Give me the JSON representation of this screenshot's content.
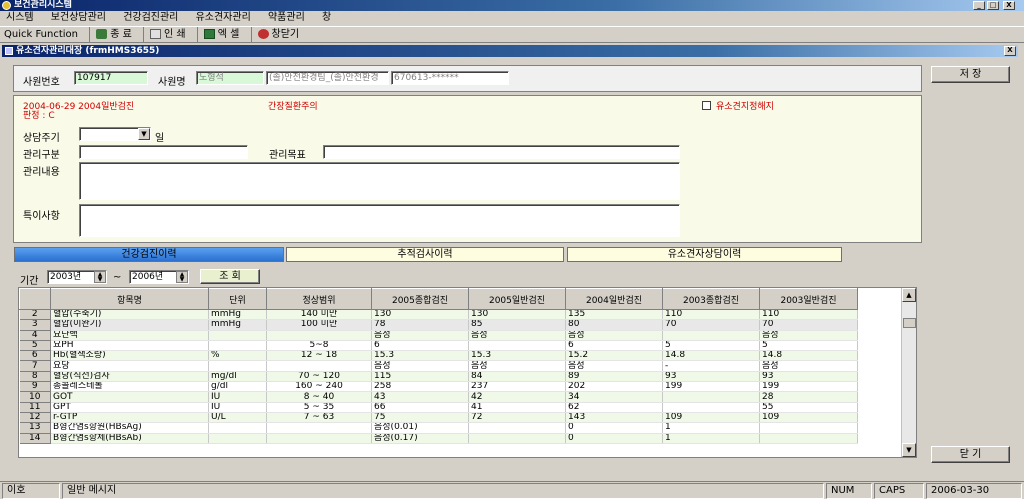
{
  "app": {
    "title": "보건관리시스템",
    "min": "_",
    "restore": "□",
    "close": "X"
  },
  "menu": [
    "시스템",
    "보건상담관리",
    "건강검진관리",
    "유소견자관리",
    "약품관리",
    "창"
  ],
  "quickbar": {
    "label": "Quick Function",
    "items": [
      "종 료",
      "인 쇄",
      "엑 셀",
      "창닫기"
    ]
  },
  "child": {
    "title": "유소견자관리대장 (frmHMS3655)",
    "close": "X"
  },
  "employee": {
    "id_label": "사원번호",
    "id_value": "107917",
    "name_label": "사원명",
    "name_value": "노형석",
    "dept_value": "(졸)안전환경팀_(졸)안전환경",
    "ssn_value": "670613-******"
  },
  "exam": {
    "line1": "2004-06-29 2004일반검진",
    "line2": "판정 : C",
    "warning": "간장질환주의",
    "release_label": "유소견지정해지"
  },
  "form": {
    "cycle_label": "상담주기",
    "cycle_unit": "일",
    "mgmt_type_label": "관리구분",
    "mgmt_goal_label": "관리목표",
    "mgmt_content_label": "관리내용",
    "special_label": "특이사항"
  },
  "buttons": {
    "save": "저 장",
    "close": "닫 기",
    "search": "조 회"
  },
  "tabs": [
    "건강검진이력",
    "추적검사이력",
    "유소견자상담이력"
  ],
  "period": {
    "label": "기간",
    "from": "2003년",
    "tilde": "~",
    "to": "2006년"
  },
  "grid": {
    "headers": [
      "항목명",
      "단위",
      "정상범위",
      "2005종합검진",
      "2005일반검진",
      "2004일반검진",
      "2003종합검진",
      "2003일반검진"
    ],
    "rows": [
      [
        "2",
        "혈압(수축기)",
        "mmHg",
        "140 미만",
        "130",
        "130",
        "135",
        "110",
        "110"
      ],
      [
        "3",
        "혈압(이완기)",
        "mmHg",
        "100 미만",
        "78",
        "85",
        "80",
        "70",
        "70"
      ],
      [
        "4",
        "요단백",
        "",
        "",
        "음성",
        "음성",
        "음성",
        "",
        "음성"
      ],
      [
        "5",
        "요PH",
        "",
        "5~8",
        "6",
        "",
        "6",
        "5",
        "5"
      ],
      [
        "6",
        "Hb(혈색소량)",
        "%",
        "12 ~ 18",
        "15.3",
        "15.3",
        "15.2",
        "14.8",
        "14.8"
      ],
      [
        "7",
        "요당",
        "",
        "",
        "음성",
        "음성",
        "음성",
        "-",
        "음성"
      ],
      [
        "8",
        "혈당(식전)검사",
        "mg/dl",
        "70 ~ 120",
        "115",
        "84",
        "89",
        "93",
        "93"
      ],
      [
        "9",
        "총콜레스테롤",
        "g/dl",
        "160 ~ 240",
        "258",
        "237",
        "202",
        "199",
        "199"
      ],
      [
        "10",
        "GOT",
        "IU",
        "8 ~ 40",
        "43",
        "42",
        "34",
        "",
        "28"
      ],
      [
        "11",
        "GPT",
        "IU",
        "5 ~ 35",
        "66",
        "41",
        "62",
        "",
        "55"
      ],
      [
        "12",
        "r-GTP",
        "U/L",
        "7 ~ 63",
        "75",
        "72",
        "143",
        "109",
        "109"
      ],
      [
        "13",
        "B형간염s항원(HBsAg)",
        "",
        "",
        "음성(0.01)",
        "",
        "0",
        "1",
        ""
      ],
      [
        "14",
        "B형간염s항체(HBsAb)",
        "",
        "",
        "음성(0.17)",
        "",
        "0",
        "1",
        ""
      ]
    ]
  },
  "status": {
    "p1": "이호",
    "p2": "일반 메시지",
    "num": "NUM",
    "caps": "CAPS",
    "date": "2006-03-30"
  }
}
